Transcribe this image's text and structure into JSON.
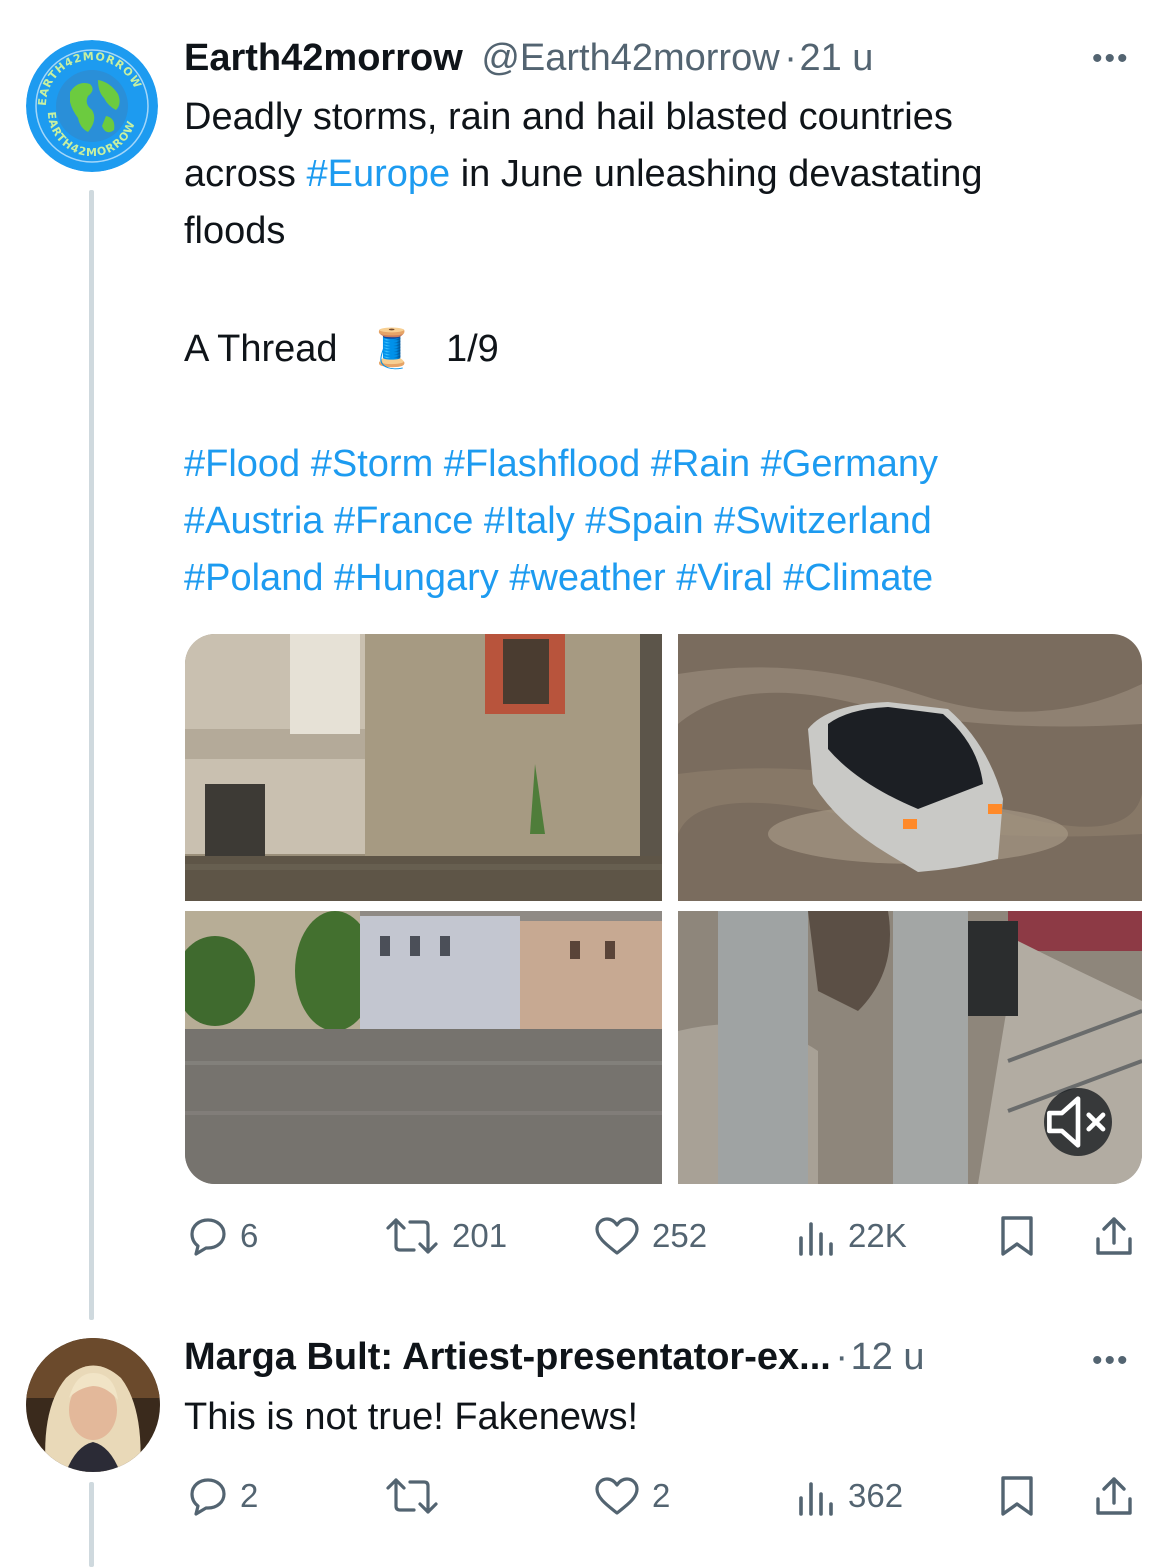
{
  "tweet": {
    "author_name": "Earth42morrow",
    "author_handle": "@Earth42morrow",
    "time": "21 u",
    "avatar_logo_text": "EARTH42MORROW",
    "text_line1": "Deadly storms, rain and hail blasted countries",
    "text_line2_pre": "across ",
    "text_line2_tag": "#Europe",
    "text_line2_post": " in June unleashing devastating",
    "text_line3": "floods",
    "thread_label": "A Thread",
    "thread_emoji": "🧵",
    "thread_count": "1/9",
    "hashtags_line1": "#Flood #Storm #Flashflood #Rain #Germany",
    "hashtags_line2": "#Austria #France #Italy #Spain #Switzerland",
    "hashtags_line3": "#Poland #Hungary #weather #Viral #Climate",
    "stats": {
      "replies": "6",
      "retweets": "201",
      "likes": "252",
      "views": "22K"
    }
  },
  "reply": {
    "author_name": "Marga Bult: Artiest-presentator-ex...",
    "time": "12 u",
    "text": "This is not true! Fakenews!",
    "stats": {
      "replies": "2",
      "retweets": "",
      "likes": "2",
      "views": "362"
    }
  },
  "more_glyph": "•••",
  "dot_separator": " · ",
  "colors": {
    "accent": "#1d9bf0",
    "muted": "#536471",
    "text": "#0f1419",
    "thread_line": "#cfd9de"
  }
}
